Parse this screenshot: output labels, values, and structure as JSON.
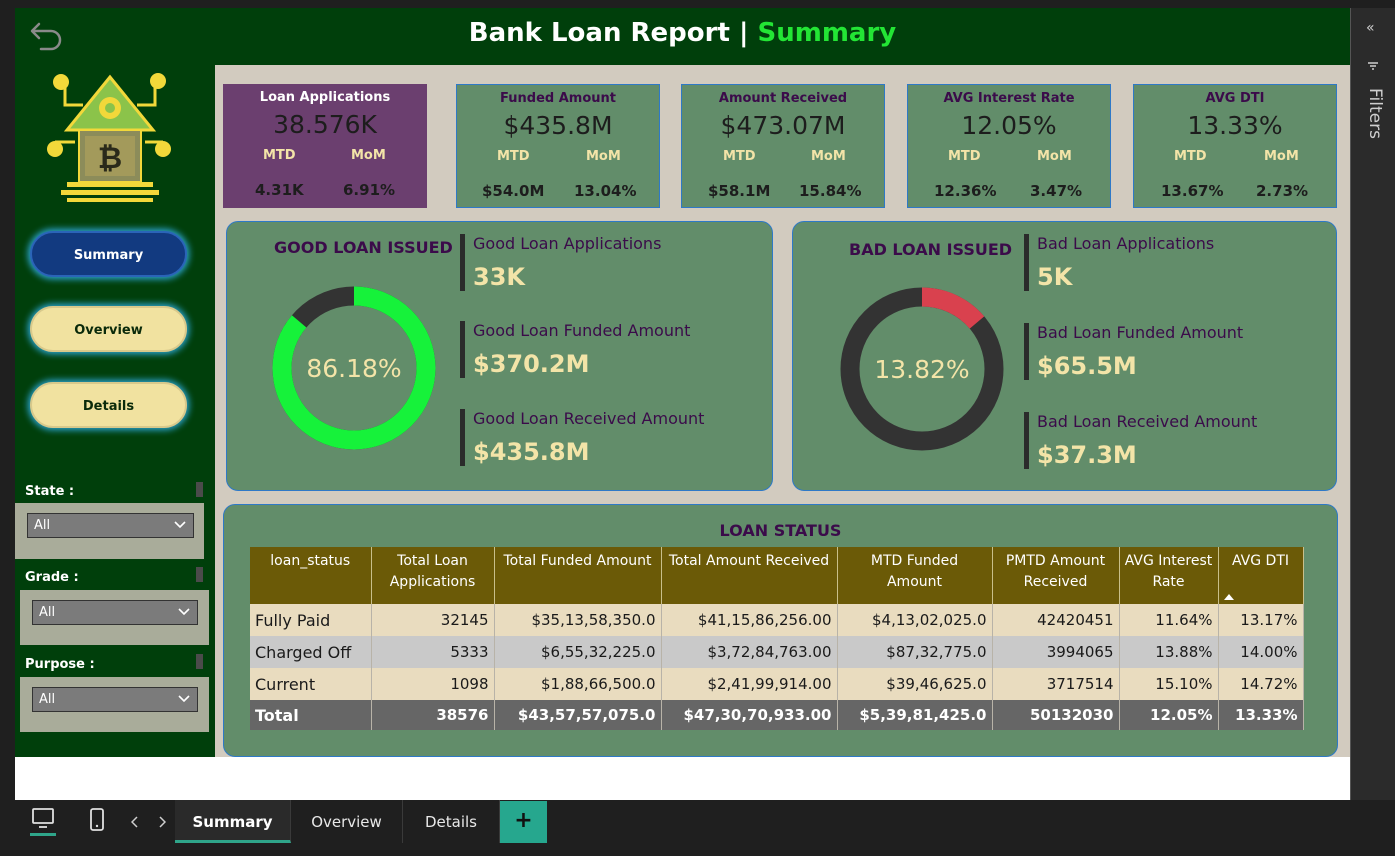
{
  "header": {
    "title_main": "Bank Loan Report | ",
    "title_accent": "Summary",
    "back_icon": "back-arrow-icon"
  },
  "sidebar": {
    "nav": [
      {
        "label": "Summary",
        "active": true
      },
      {
        "label": "Overview",
        "active": false
      },
      {
        "label": "Details",
        "active": false
      }
    ],
    "slicers": [
      {
        "label": "State :",
        "value": "All"
      },
      {
        "label": "Grade :",
        "value": "All"
      },
      {
        "label": "Purpose :",
        "value": "All"
      }
    ]
  },
  "kpis": [
    {
      "title": "Loan Applications",
      "value": "38.576K",
      "mtd_label": "MTD",
      "mom_label": "MoM",
      "mtd": "4.31K",
      "mom": "6.91%"
    },
    {
      "title": "Funded Amount",
      "value": "$435.8M",
      "mtd_label": "MTD",
      "mom_label": "MoM",
      "mtd": "$54.0M",
      "mom": "13.04%"
    },
    {
      "title": "Amount Received",
      "value": "$473.07M",
      "mtd_label": "MTD",
      "mom_label": "MoM",
      "mtd": "$58.1M",
      "mom": "15.84%"
    },
    {
      "title": "AVG Interest Rate",
      "value": "12.05%",
      "mtd_label": "MTD",
      "mom_label": "MoM",
      "mtd": "12.36%",
      "mom": "3.47%"
    },
    {
      "title": "AVG DTI",
      "value": "13.33%",
      "mtd_label": "MTD",
      "mom_label": "MoM",
      "mtd": "13.67%",
      "mom": "2.73%"
    }
  ],
  "good_loan": {
    "title": "GOOD LOAN ISSUED",
    "percent_label": "86.18%",
    "percent": 86.18,
    "color": "#16f23a",
    "rest_color": "#333333",
    "metrics": [
      {
        "label": "Good Loan Applications",
        "value": "33K"
      },
      {
        "label": "Good Loan Funded Amount",
        "value": "$370.2M"
      },
      {
        "label": "Good Loan Received Amount",
        "value": "$435.8M"
      }
    ]
  },
  "bad_loan": {
    "title": "BAD LOAN ISSUED",
    "percent_label": "13.82%",
    "percent": 13.82,
    "color": "#d9414e",
    "rest_color": "#333333",
    "metrics": [
      {
        "label": "Bad Loan Applications",
        "value": "5K"
      },
      {
        "label": "Bad Loan Funded Amount",
        "value": "$65.5M"
      },
      {
        "label": "Bad Loan Received Amount",
        "value": "$37.3M"
      }
    ]
  },
  "loan_status": {
    "title": "LOAN STATUS",
    "columns": [
      "loan_status",
      "Total Loan Applications",
      "Total Funded Amount",
      "Total Amount Received",
      "MTD Funded Amount",
      "PMTD Amount Received",
      "AVG Interest Rate",
      "AVG DTI"
    ],
    "rows": [
      [
        "Fully Paid",
        "32145",
        "$35,13,58,350.0",
        "$41,15,86,256.00",
        "$4,13,02,025.0",
        "42420451",
        "11.64%",
        "13.17%"
      ],
      [
        "Charged Off",
        "5333",
        "$6,55,32,225.0",
        "$3,72,84,763.00",
        "$87,32,775.0",
        "3994065",
        "13.88%",
        "14.00%"
      ],
      [
        "Current",
        "1098",
        "$1,88,66,500.0",
        "$2,41,99,914.00",
        "$39,46,625.0",
        "3717514",
        "15.10%",
        "14.72%"
      ]
    ],
    "total": [
      "Total",
      "38576",
      "$43,57,57,075.0",
      "$47,30,70,933.00",
      "$5,39,81,425.0",
      "50132030",
      "12.05%",
      "13.33%"
    ]
  },
  "filters_pane": {
    "label": "Filters",
    "collapse_icon": "double-chevron-left-icon"
  },
  "bottom_bar": {
    "tabs": [
      "Summary",
      "Overview",
      "Details"
    ],
    "active_tab": "Summary",
    "add_label": "+"
  }
}
